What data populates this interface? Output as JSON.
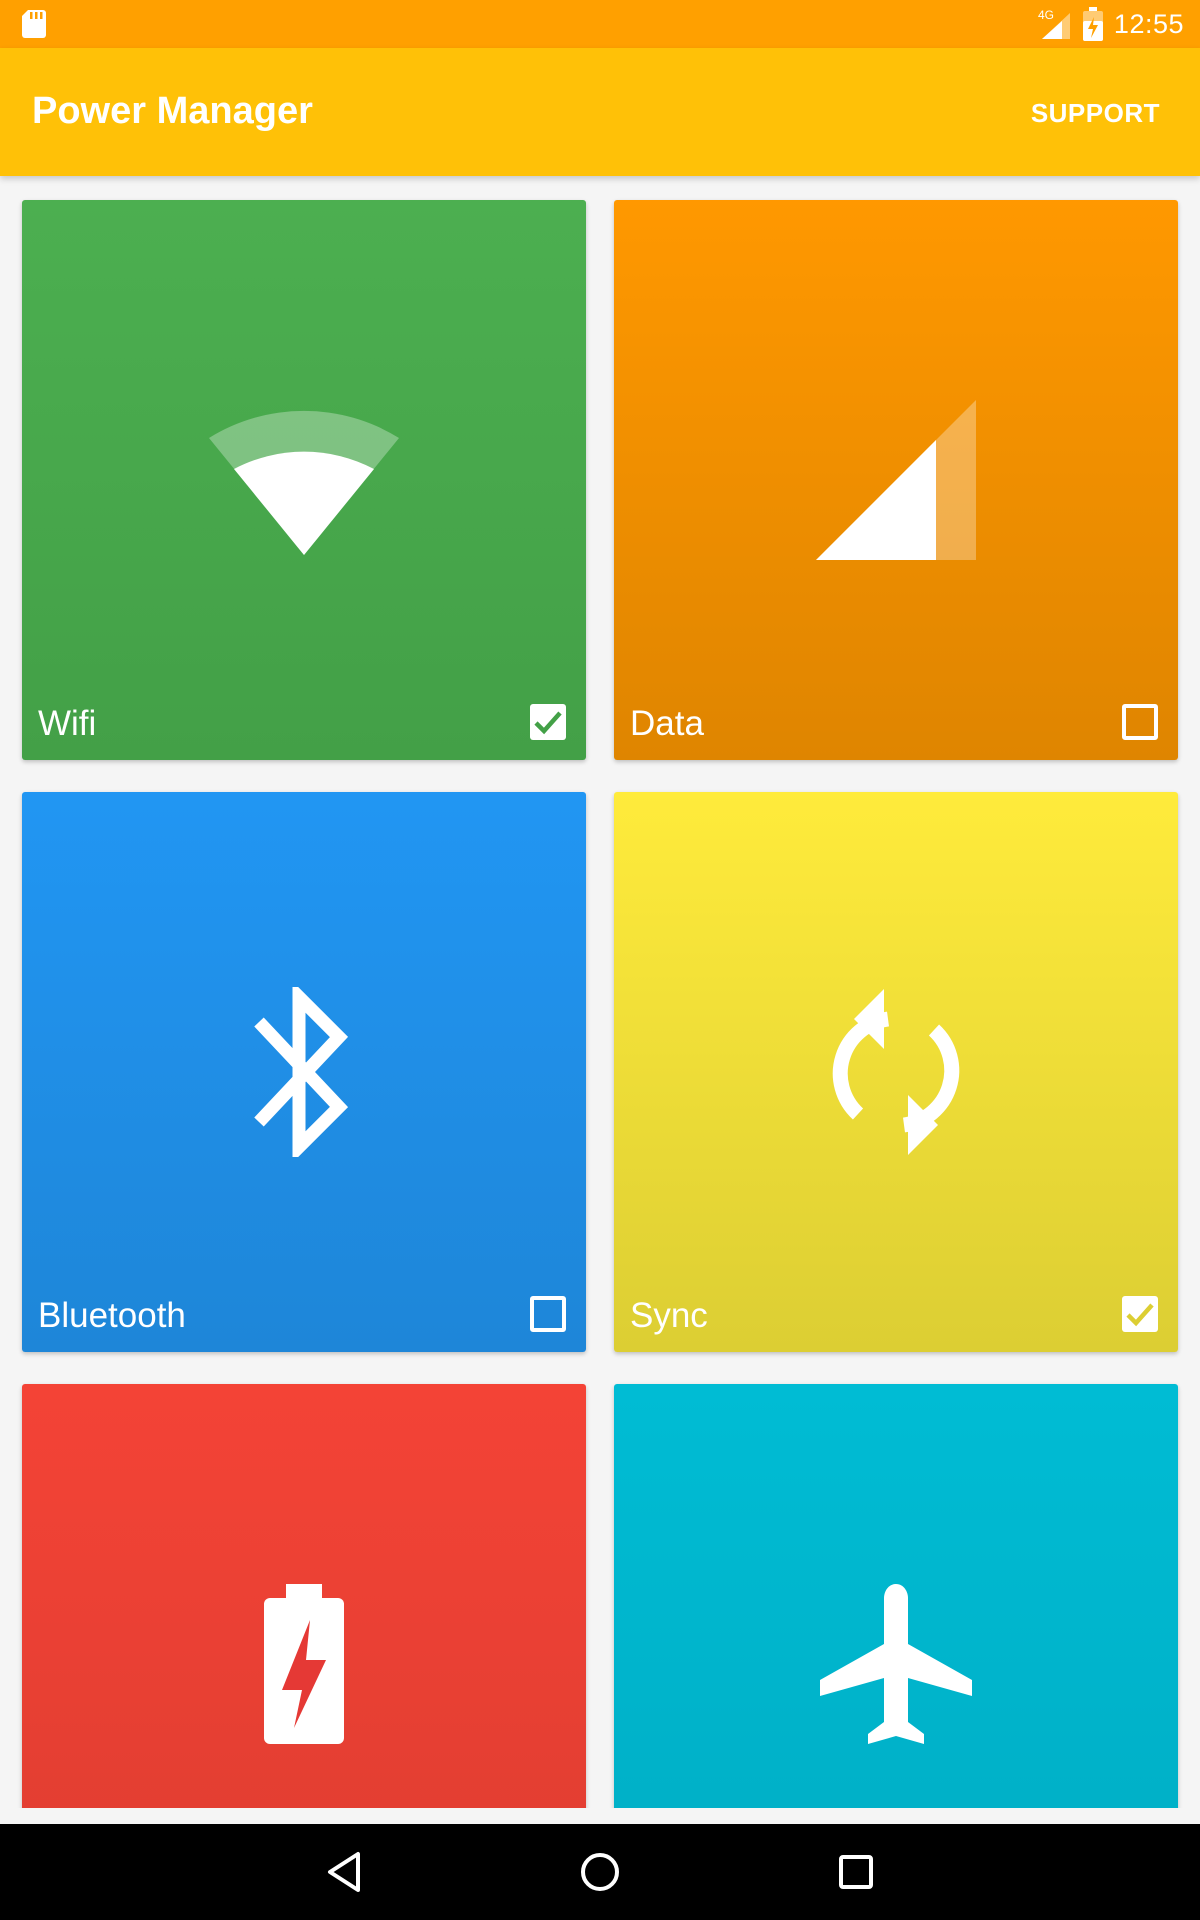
{
  "status_bar": {
    "time": "12:55",
    "network": "4G",
    "icons": [
      "sd-card-icon",
      "cell-signal-icon",
      "battery-charging-icon"
    ]
  },
  "app_bar": {
    "title": "Power Manager",
    "support_label": "SUPPORT",
    "color": "#ffc107"
  },
  "tiles": [
    {
      "label": "Wifi",
      "checked": true,
      "icon": "wifi-icon",
      "color_top": "#4caf50",
      "color_bottom": "#43a047"
    },
    {
      "label": "Data",
      "checked": false,
      "icon": "cell-signal-icon",
      "color_top": "#ff9800",
      "color_bottom": "#df8500"
    },
    {
      "label": "Bluetooth",
      "checked": false,
      "icon": "bluetooth-icon",
      "color_top": "#2196f3",
      "color_bottom": "#1e86d8"
    },
    {
      "label": "Sync",
      "checked": true,
      "icon": "sync-icon",
      "color_top": "#ffeb3b",
      "color_bottom": "#dcce33"
    },
    {
      "label": "",
      "checked": false,
      "icon": "battery-charging-icon",
      "color_top": "#f44336",
      "color_bottom": "#de3d31"
    },
    {
      "label": "",
      "checked": false,
      "icon": "airplane-icon",
      "color_top": "#00bcd4",
      "color_bottom": "#00adc4"
    }
  ],
  "nav_bar": {
    "icons": [
      "back-icon",
      "home-icon",
      "recents-icon"
    ]
  }
}
